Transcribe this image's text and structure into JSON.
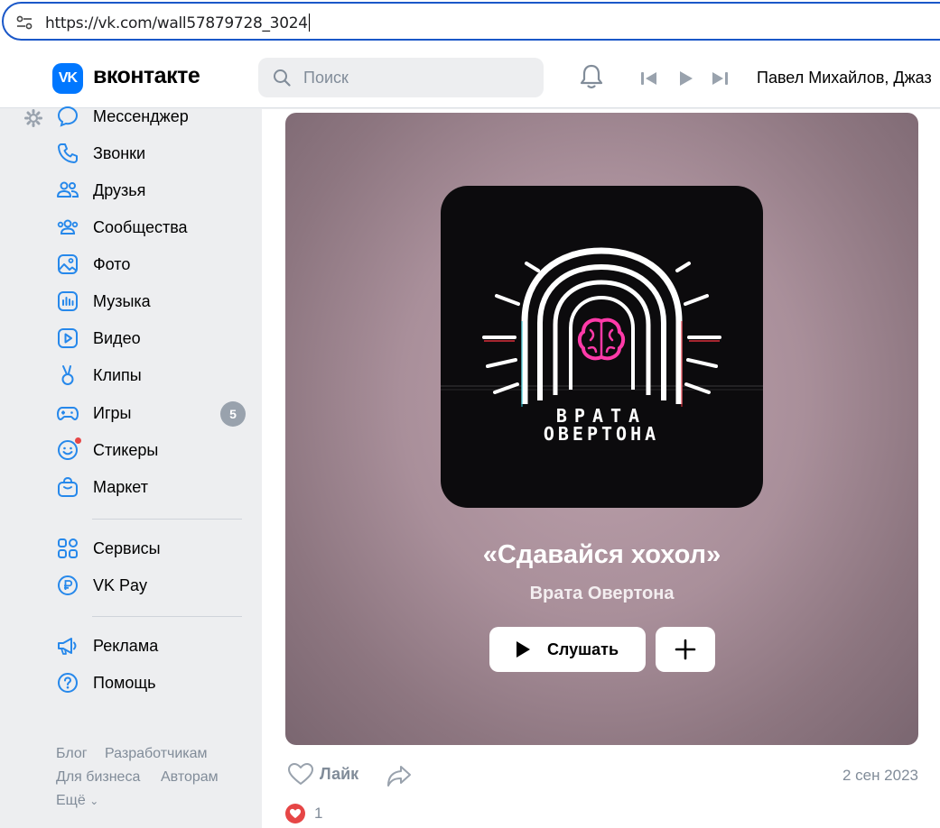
{
  "browser": {
    "url": "https://vk.com/wall57879728_3024"
  },
  "header": {
    "logo_text": "вконтакте",
    "logo_mark": "VK",
    "search_placeholder": "Поиск",
    "now_playing": "Павел Михайлов, Джаз",
    "icons": [
      "notifications-bell-icon",
      "previous-track-icon",
      "play-icon",
      "next-track-icon"
    ]
  },
  "sidebar": {
    "items": [
      {
        "label": "Мессенджер",
        "icon": "messenger-icon"
      },
      {
        "label": "Звонки",
        "icon": "phone-icon"
      },
      {
        "label": "Друзья",
        "icon": "friends-icon"
      },
      {
        "label": "Сообщества",
        "icon": "communities-icon"
      },
      {
        "label": "Фото",
        "icon": "photo-icon"
      },
      {
        "label": "Музыка",
        "icon": "music-icon"
      },
      {
        "label": "Видео",
        "icon": "video-icon"
      },
      {
        "label": "Клипы",
        "icon": "clips-icon"
      },
      {
        "label": "Игры",
        "icon": "games-icon",
        "badge": "5"
      },
      {
        "label": "Стикеры",
        "icon": "stickers-icon"
      },
      {
        "label": "Маркет",
        "icon": "market-icon"
      },
      {
        "label": "Сервисы",
        "icon": "services-icon"
      },
      {
        "label": "VK Pay",
        "icon": "vkpay-icon"
      },
      {
        "label": "Реклама",
        "icon": "advertising-icon"
      },
      {
        "label": "Помощь",
        "icon": "help-icon"
      }
    ],
    "footer": {
      "blog": "Блог",
      "developers": "Разработчикам",
      "business": "Для бизнеса",
      "authors": "Авторам",
      "more": "Ещё"
    }
  },
  "post": {
    "cover_text_line1": "ВРАТА",
    "cover_text_line2": "ОВЕРТОНА",
    "song_title": "«Сдавайся хохол»",
    "artist": "Врата Овертона",
    "listen_label": "Слушать",
    "like_label": "Лайк",
    "date": "2 сен 2023",
    "reactions_count": "1"
  },
  "colors": {
    "accent": "#0077ff",
    "sidebar_bg": "#edeef0",
    "badge": "#99a2ad",
    "heart": "#e64646",
    "brain": "#ff3aa8"
  }
}
